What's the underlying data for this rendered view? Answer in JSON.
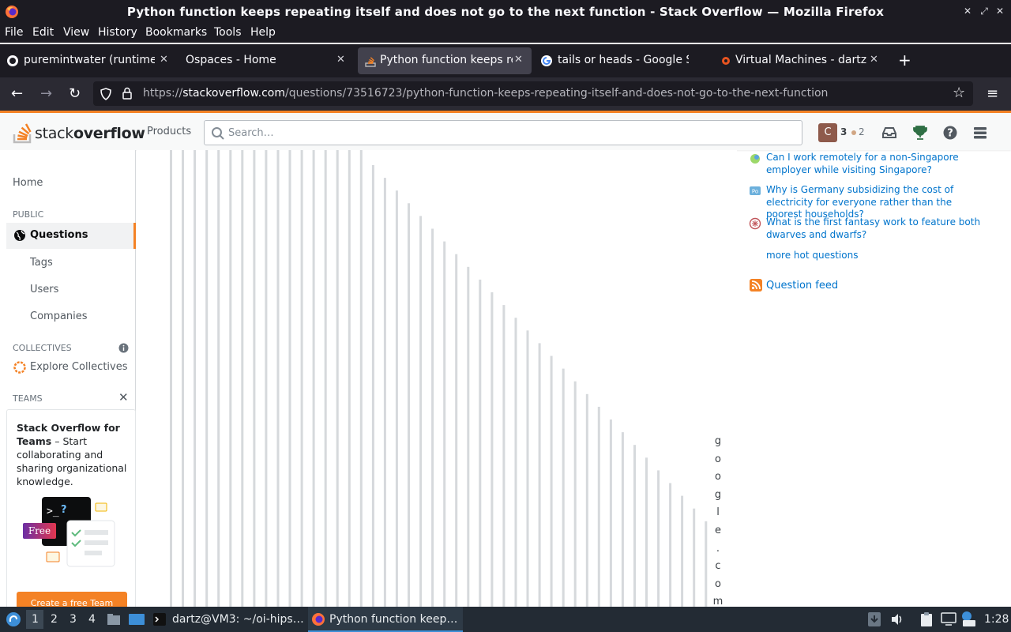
{
  "window": {
    "title": "Python function keeps repeating itself and does not go to the next function - Stack Overflow — Mozilla Firefox"
  },
  "menu": [
    "File",
    "Edit",
    "View",
    "History",
    "Bookmarks",
    "Tools",
    "Help"
  ],
  "tabs": [
    {
      "label": "puremintwater (runtime)",
      "icon": "github-icon",
      "active": false
    },
    {
      "label": "Ospaces - Home",
      "icon": "",
      "active": false
    },
    {
      "label": "Python function keeps re",
      "icon": "stackoverflow-icon",
      "active": true
    },
    {
      "label": "tails or heads - Google Se",
      "icon": "google-icon",
      "active": false
    },
    {
      "label": "Virtual Machines - dartz@",
      "icon": "ubuntu-icon",
      "active": false
    }
  ],
  "urlbar": {
    "prefix": "https://",
    "host": "stackoverflow.com",
    "path": "/questions/73516723/python-function-keeps-repeating-itself-and-does-not-go-to-the-next-function"
  },
  "so_header": {
    "logo_light": "stack",
    "logo_bold": "overflow",
    "products_label": "Products",
    "search_placeholder": "Search…",
    "avatar_letter": "C",
    "reputation": "3",
    "bronze_badges": "2"
  },
  "left_nav": {
    "home": "Home",
    "public_heading": "PUBLIC",
    "questions": "Questions",
    "tags": "Tags",
    "users": "Users",
    "companies": "Companies",
    "collectives_heading": "COLLECTIVES",
    "explore_collectives": "Explore Collectives",
    "teams_heading": "TEAMS",
    "teams_title": "Stack Overflow for Teams",
    "teams_body": "– Start collaborating and sharing organizational knowledge.",
    "free_badge": "Free",
    "cta_label": "Create a free Team"
  },
  "main": {
    "vertical_text": [
      "g",
      "o",
      "o",
      "g",
      "l",
      "e",
      ".",
      "c",
      "o",
      "m"
    ]
  },
  "right_sidebar": {
    "hot_questions": [
      {
        "title": "Can I work remotely for a non-Singapore employer while visiting Singapore?",
        "site_icon": "expatriates-icon"
      },
      {
        "title": "Why is Germany subsidizing the cost of electricity for everyone rather than the poorest households?",
        "site_icon": "politics-icon"
      },
      {
        "title": "What is the first fantasy work to feature both dwarves and dwarfs?",
        "site_icon": "scifi-icon"
      }
    ],
    "more_hot": "more hot questions",
    "question_feed": "Question feed"
  },
  "taskbar": {
    "workspaces": [
      "1",
      "2",
      "3",
      "4"
    ],
    "terminal_task": "dartz@VM3: ~/oi-hips…",
    "firefox_task": "Python function keep…",
    "clock": "1:28"
  },
  "colors": {
    "so_orange": "#f48225",
    "link_blue": "#0074cc",
    "firefox_dark": "#1c1b22"
  }
}
